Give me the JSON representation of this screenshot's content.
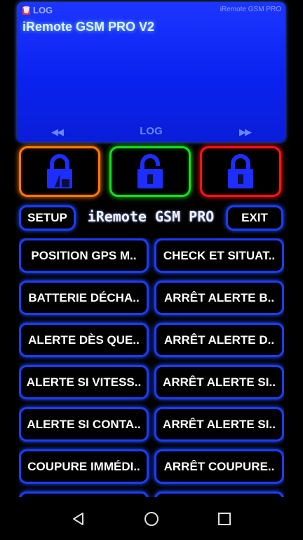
{
  "log": {
    "header_label": "LOG",
    "app_name": "iRemote GSM PRO",
    "content": "iRemote GSM PRO V2",
    "footer_label": "LOG",
    "prev_symbol": "◀◀",
    "next_symbol": "▶▶",
    "delete_icon": "trash-icon"
  },
  "locks": [
    {
      "name": "lock-partial",
      "color": "#ff7a00",
      "icon": "partial-lock-icon"
    },
    {
      "name": "unlock",
      "color": "#13e01a",
      "icon": "unlock-icon"
    },
    {
      "name": "lock",
      "color": "#ff1212",
      "icon": "lock-icon"
    }
  ],
  "toolbar": {
    "setup_label": "SETUP",
    "title": "iRemote GSM PRO",
    "exit_label": "EXIT"
  },
  "commands": [
    {
      "label": "POSITION GPS M..",
      "name": "cmd-position-gps"
    },
    {
      "label": "CHECK ET SITUAT..",
      "name": "cmd-check-situation"
    },
    {
      "label": "BATTERIE DÉCHA..",
      "name": "cmd-batterie-decharge"
    },
    {
      "label": "ARRÊT ALERTE B..",
      "name": "cmd-arret-alerte-batterie"
    },
    {
      "label": "ALERTE DÈS QUE..",
      "name": "cmd-alerte-des-que"
    },
    {
      "label": "ARRÊT ALERTE D..",
      "name": "cmd-arret-alerte-des-que"
    },
    {
      "label": "ALERTE SI VITESS..",
      "name": "cmd-alerte-vitesse"
    },
    {
      "label": "ARRÊT ALERTE SI..",
      "name": "cmd-arret-alerte-vitesse"
    },
    {
      "label": "ALERTE SI CONTA..",
      "name": "cmd-alerte-contact"
    },
    {
      "label": "ARRÊT ALERTE SI..",
      "name": "cmd-arret-alerte-contact"
    },
    {
      "label": "COUPURE IMMÉDI..",
      "name": "cmd-coupure-immediate"
    },
    {
      "label": "ARRÊT COUPURE..",
      "name": "cmd-arret-coupure"
    },
    {
      "label": "",
      "name": "cmd-partial-left"
    },
    {
      "label": "",
      "name": "cmd-partial-right"
    }
  ],
  "colors": {
    "accent_blue": "#1c3cff",
    "panel_blue": "#0a22ef",
    "orange": "#ff7a00",
    "green": "#13e01a",
    "red": "#ff1212"
  },
  "nav": {
    "back_icon": "back-triangle-icon",
    "home_icon": "home-circle-icon",
    "recents_icon": "recents-square-icon"
  }
}
